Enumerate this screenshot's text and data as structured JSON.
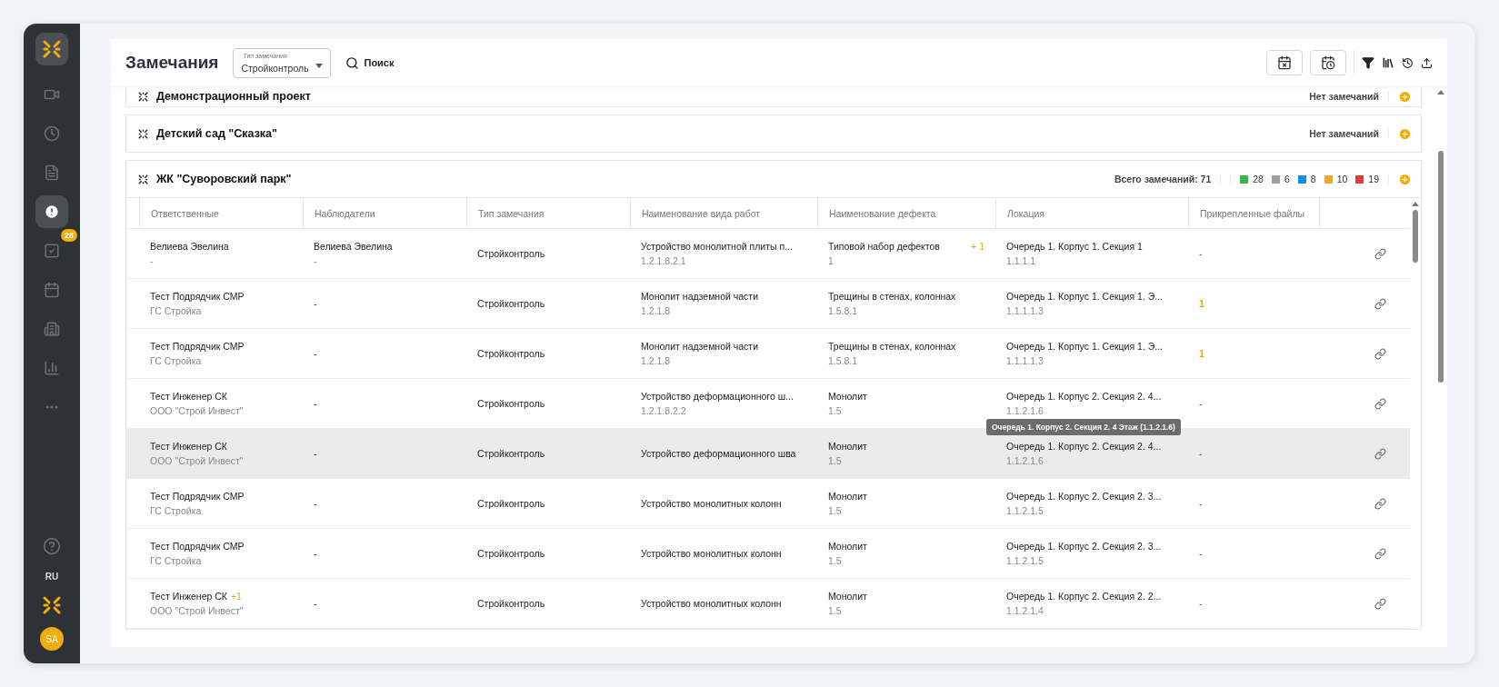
{
  "sidebar": {
    "items": [
      {
        "kind": "video",
        "selected": false
      },
      {
        "kind": "clock",
        "selected": false
      },
      {
        "kind": "document",
        "selected": false
      },
      {
        "kind": "alert",
        "selected": true
      },
      {
        "kind": "check",
        "selected": false,
        "badge": "28"
      },
      {
        "kind": "calendar",
        "selected": false
      },
      {
        "kind": "building",
        "selected": false
      },
      {
        "kind": "chart",
        "selected": false
      },
      {
        "kind": "more",
        "selected": false
      }
    ],
    "language": "RU",
    "avatar": "SA"
  },
  "header": {
    "title": "Замечания",
    "type_select": {
      "label": "Тип замечания",
      "value": "Стройконтроль"
    },
    "search": "Поиск"
  },
  "projects": [
    {
      "name": "Демонстрационный проект",
      "expanded": false,
      "status": "Нет замечаний"
    },
    {
      "name": "Детский сад \"Сказка\"",
      "expanded": false,
      "status": "Нет замечаний"
    },
    {
      "name": "ЖК \"Суворовский парк\"",
      "expanded": true,
      "total": "Всего замечаний: 71",
      "counts": [
        {
          "value": "28",
          "color": "#3cb54a"
        },
        {
          "value": "6",
          "color": "#9aa0a8"
        },
        {
          "value": "8",
          "color": "#1e88e5"
        },
        {
          "value": "10",
          "color": "#f5a623"
        },
        {
          "value": "19",
          "color": "#e53935"
        }
      ]
    }
  ],
  "table": {
    "columns": [
      "Ответственные",
      "Наблюдатели",
      "Тип замечания",
      "Наименование вида работ",
      "Наименование дефекта",
      "Локация",
      "Прикрепленные файлы"
    ],
    "rows": [
      {
        "selected": false,
        "responsible": {
          "name": "Велиева Эвелина",
          "org": "-"
        },
        "observer": {
          "name": "Велиева Эвелина",
          "org": "-"
        },
        "type": "Стройконтроль",
        "work": {
          "name": "Устройство монолитной плиты п...",
          "code": "1.2.1.8.2.1"
        },
        "defect": {
          "name": "Типовой набор дефектов",
          "code": "1",
          "extra": "+ 1"
        },
        "location": {
          "name": "Очередь 1. Корпус 1. Секция 1",
          "code": "1.1.1.1"
        },
        "files": {
          "kind": "none",
          "text": "-"
        }
      },
      {
        "selected": false,
        "responsible": {
          "name": "Тест Подрядчик СМР",
          "org": "ГС Стройка"
        },
        "observer": {
          "name": "-"
        },
        "type": "Стройконтроль",
        "work": {
          "name": "Монолит надземной части",
          "code": "1.2.1.8"
        },
        "defect": {
          "name": "Трещины в стенах, колоннах",
          "code": "1.5.8.1"
        },
        "location": {
          "name": "Очередь 1. Корпус 1. Секция 1. Э...",
          "code": "1.1.1.1.3"
        },
        "files": {
          "kind": "count",
          "text": "1"
        }
      },
      {
        "selected": false,
        "responsible": {
          "name": "Тест Подрядчик СМР",
          "org": "ГС Стройка"
        },
        "observer": {
          "name": "-"
        },
        "type": "Стройконтроль",
        "work": {
          "name": "Монолит надземной части",
          "code": "1.2.1.8"
        },
        "defect": {
          "name": "Трещины в стенах, колоннах",
          "code": "1.5.8.1"
        },
        "location": {
          "name": "Очередь 1. Корпус 1. Секция 1. Э...",
          "code": "1.1.1.1.3"
        },
        "files": {
          "kind": "count",
          "text": "1"
        }
      },
      {
        "selected": false,
        "responsible": {
          "name": "Тест Инженер СК",
          "org": "ООО \"Строй Инвест\""
        },
        "observer": {
          "name": "-"
        },
        "type": "Стройконтроль",
        "work": {
          "name": "Устройство деформационного ш...",
          "code": "1.2.1.8.2.2"
        },
        "defect": {
          "name": "Монолит",
          "code": "1.5"
        },
        "location": {
          "name": "Очередь 1. Корпус 2. Секция 2. 4...",
          "code": "1.1.2.1.6",
          "tooltip": "Очередь 1. Корпус 2. Секция 2. 4 Этаж (1.1.2.1.6)"
        },
        "files": {
          "kind": "none",
          "text": "-"
        }
      },
      {
        "selected": true,
        "responsible": {
          "name": "Тест Инженер СК",
          "org": "ООО \"Строй Инвест\""
        },
        "observer": {
          "name": "-"
        },
        "type": "Стройконтроль",
        "work": {
          "name": "Устройство деформационного шва"
        },
        "defect": {
          "name": "Монолит",
          "code": "1.5"
        },
        "location": {
          "name": "Очередь 1. Корпус 2. Секция 2. 4...",
          "code": "1.1.2.1.6"
        },
        "files": {
          "kind": "none",
          "text": "-"
        }
      },
      {
        "selected": false,
        "responsible": {
          "name": "Тест Подрядчик СМР",
          "org": "ГС Стройка"
        },
        "observer": {
          "name": "-"
        },
        "type": "Стройконтроль",
        "work": {
          "name": "Устройство монолитных колонн"
        },
        "defect": {
          "name": "Монолит",
          "code": "1.5"
        },
        "location": {
          "name": "Очередь 1. Корпус 2. Секция 2. 3...",
          "code": "1.1.2.1.5"
        },
        "files": {
          "kind": "none",
          "text": "-"
        }
      },
      {
        "selected": false,
        "responsible": {
          "name": "Тест Подрядчик СМР",
          "org": "ГС Стройка"
        },
        "observer": {
          "name": "-"
        },
        "type": "Стройконтроль",
        "work": {
          "name": "Устройство монолитных колонн"
        },
        "defect": {
          "name": "Монолит",
          "code": "1.5"
        },
        "location": {
          "name": "Очередь 1. Корпус 2. Секция 2. 3...",
          "code": "1.1.2.1.5"
        },
        "files": {
          "kind": "none",
          "text": "-"
        }
      },
      {
        "selected": false,
        "responsible": {
          "name": "Тест Инженер СК",
          "org": "ООО \"Строй Инвест\"",
          "extra": "+1"
        },
        "observer": {
          "name": "-"
        },
        "type": "Стройконтроль",
        "work": {
          "name": "Устройство монолитных колонн"
        },
        "defect": {
          "name": "Монолит",
          "code": "1.5"
        },
        "location": {
          "name": "Очередь 1. Корпус 2. Секция 2. 2...",
          "code": "1.1.2.1.4"
        },
        "files": {
          "kind": "none",
          "text": "-"
        }
      }
    ]
  }
}
